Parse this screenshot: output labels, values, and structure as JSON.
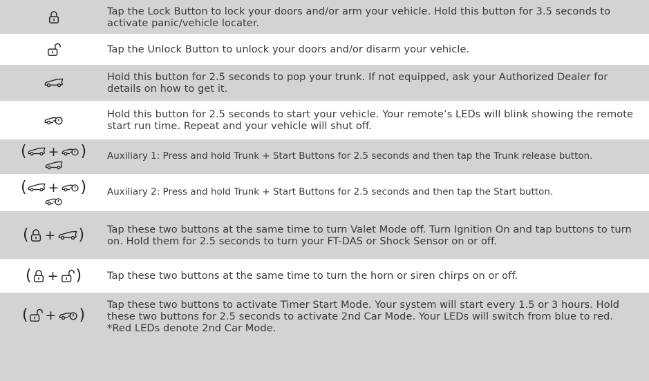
{
  "rows": [
    {
      "icons": [
        "lock-icon"
      ],
      "text": "Tap the Lock Button to lock your doors and/or arm your vehicle. Hold this button for 3.5 seconds to activate panic/vehicle locater."
    },
    {
      "icons": [
        "unlock-icon"
      ],
      "text": "Tap the Unlock Button to unlock your doors and/or disarm your vehicle."
    },
    {
      "icons": [
        "trunk-icon"
      ],
      "text": "Hold this button for 2.5 seconds to pop your trunk. If not equipped, ask your Authorized Dealer for details on how to get it."
    },
    {
      "icons": [
        "start-key-icon"
      ],
      "text": "Hold this button for 2.5 seconds to start your vehicle. Your remote’s LEDs will blink showing the remote start run time. Repeat and your vehicle will shut off."
    },
    {
      "icons": [
        "trunk-icon",
        "start-key-icon",
        "trunk-icon"
      ],
      "symbols": {
        "open": "(",
        "plus": "+",
        "close": ")"
      },
      "text": "Auxiliary 1: Press and hold Trunk + Start Buttons for 2.5 seconds and then tap the Trunk release button."
    },
    {
      "icons": [
        "trunk-icon",
        "start-key-icon",
        "start-key-icon"
      ],
      "symbols": {
        "open": "(",
        "plus": "+",
        "close": ")"
      },
      "text": "Auxiliary 2: Press and hold Trunk + Start Buttons for 2.5 seconds and then tap the Start button."
    },
    {
      "icons": [
        "lock-icon",
        "trunk-icon"
      ],
      "symbols": {
        "open": "(",
        "plus": "+",
        "close": ")"
      },
      "text": "Tap these two buttons at the same time to turn Valet Mode off. Turn Ignition On and tap buttons to turn on. Hold them for 2.5 seconds to turn your FT-DAS or Shock Sensor on or off."
    },
    {
      "icons": [
        "lock-icon",
        "unlock-icon"
      ],
      "symbols": {
        "open": "(",
        "plus": "+",
        "close": ")"
      },
      "text": "Tap these two buttons at the same time to turn the horn or siren chirps on or off."
    },
    {
      "icons": [
        "unlock-icon",
        "start-key-icon"
      ],
      "symbols": {
        "open": "(",
        "plus": "+",
        "close": ")"
      },
      "text": "Tap these two buttons to activate Timer Start Mode. Your system will start every 1.5 or 3 hours. Hold these two buttons for 2.5 seconds to activate 2nd Car Mode. Your LEDs will switch from blue to red. *Red LEDs denote 2nd Car Mode."
    }
  ]
}
